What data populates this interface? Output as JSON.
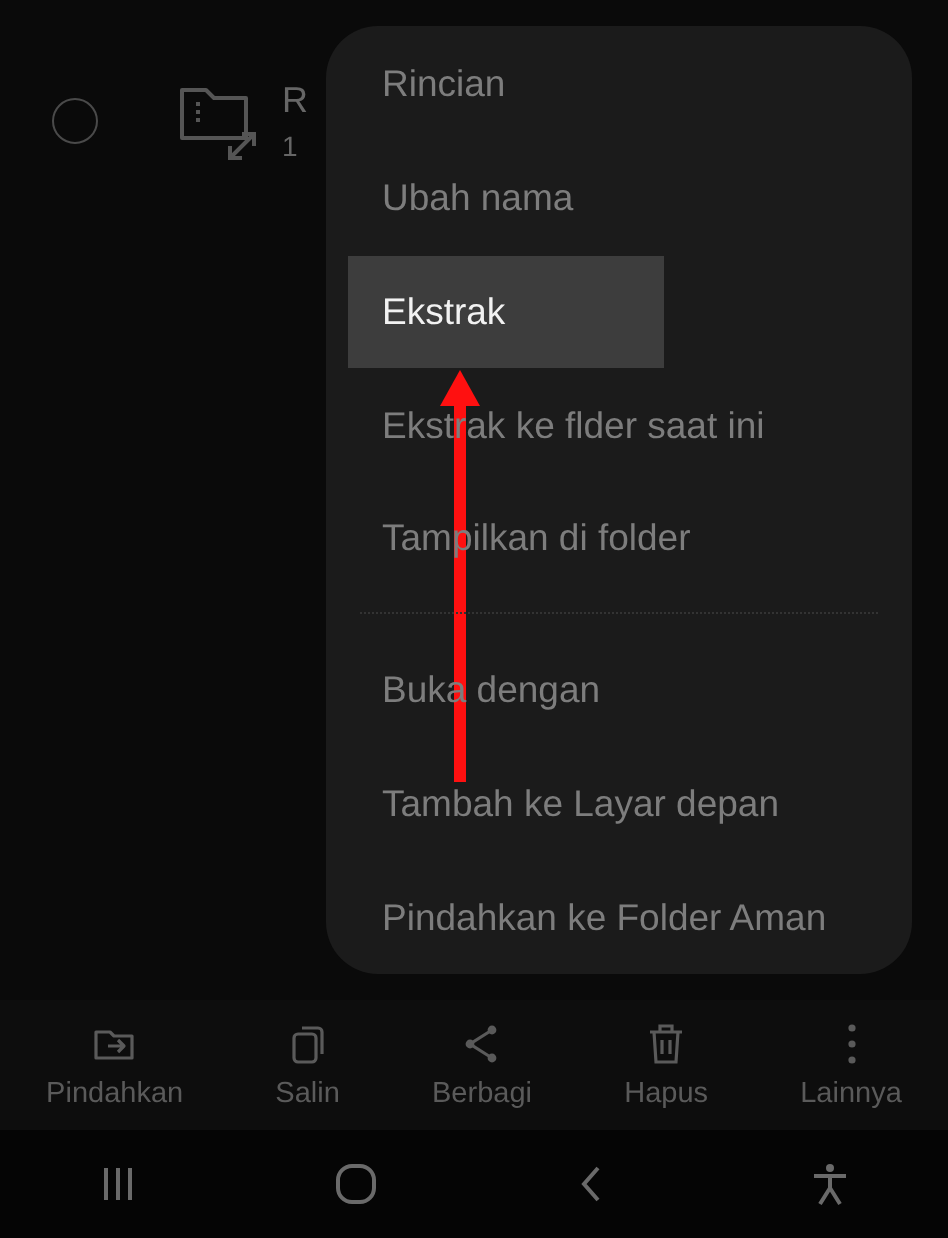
{
  "file_row": {
    "selected": false,
    "name": "R",
    "meta": "1"
  },
  "menu": {
    "groups": [
      [
        {
          "label": "Rincian",
          "selected": false
        },
        {
          "label": "Ubah nama",
          "selected": false
        },
        {
          "label": "Ekstrak",
          "selected": true
        },
        {
          "label": "Ekstrak ke flder saat ini",
          "selected": false
        },
        {
          "label": "Tampilkan di folder",
          "selected": false
        }
      ],
      [
        {
          "label": "Buka dengan",
          "selected": false
        },
        {
          "label": "Tambah ke Layar depan",
          "selected": false
        },
        {
          "label": "Pindahkan ke Folder Aman",
          "selected": false
        }
      ]
    ]
  },
  "toolbar": [
    {
      "label": "Pindahkan"
    },
    {
      "label": "Salin"
    },
    {
      "label": "Berbagi"
    },
    {
      "label": "Hapus"
    },
    {
      "label": "Lainnya"
    }
  ]
}
